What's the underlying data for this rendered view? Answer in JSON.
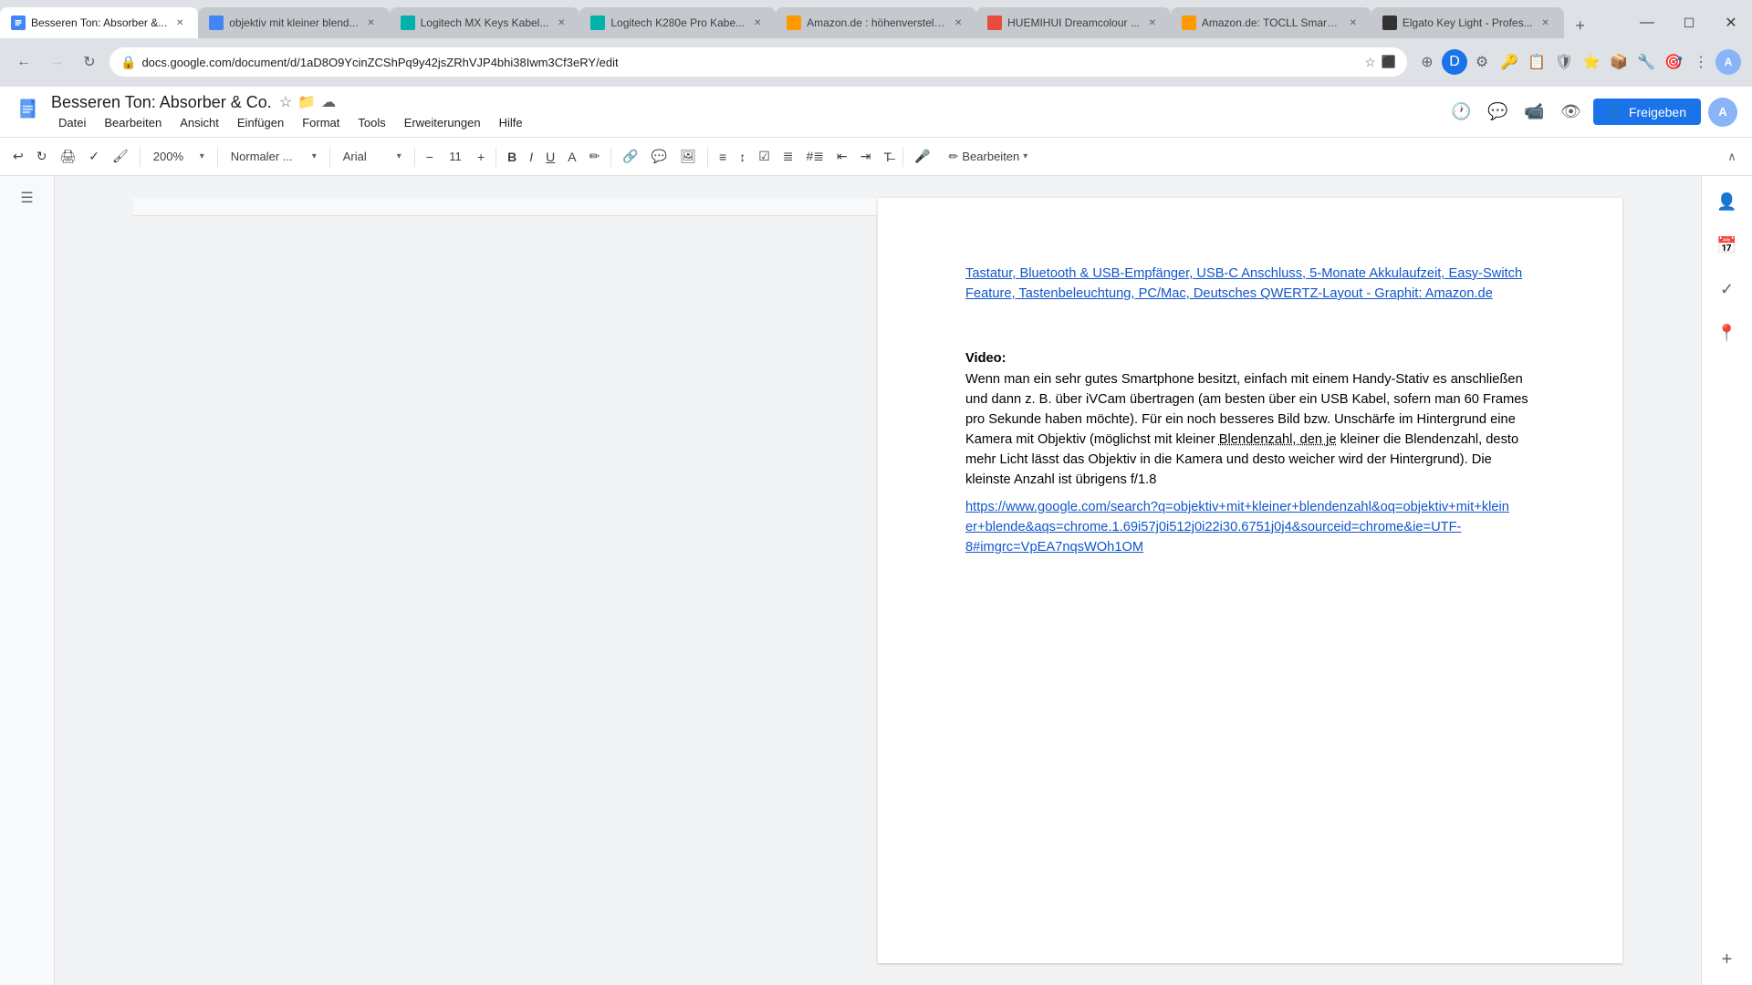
{
  "browser": {
    "tabs": [
      {
        "id": "tab1",
        "label": "Besseren Ton: Absorber &...",
        "active": true,
        "favicon_color": "#4285f4"
      },
      {
        "id": "tab2",
        "label": "objektiv mit kleiner blend...",
        "active": false,
        "favicon_color": "#4285f4"
      },
      {
        "id": "tab3",
        "label": "Logitech MX Keys Kabel...",
        "active": false,
        "favicon_color": "#00b2a9"
      },
      {
        "id": "tab4",
        "label": "Logitech K280e Pro Kabe...",
        "active": false,
        "favicon_color": "#00b2a9"
      },
      {
        "id": "tab5",
        "label": "Amazon.de : höhenverstell...",
        "active": false,
        "favicon_color": "#ff9900"
      },
      {
        "id": "tab6",
        "label": "HUEMIHUI Dreamcolour ...",
        "active": false,
        "favicon_color": "#e74c3c"
      },
      {
        "id": "tab7",
        "label": "Amazon.de: TOCLL Smart ...",
        "active": false,
        "favicon_color": "#ff9900"
      },
      {
        "id": "tab8",
        "label": "Elgato Key Light - Profes...",
        "active": false,
        "favicon_color": "#333"
      }
    ],
    "url": "docs.google.com/document/d/1aD8O9YcinZCShPq9y42jsZRhVJP4bhi38Iwm3Cf3eRY/edit",
    "nav": {
      "back_disabled": false,
      "forward_disabled": false
    }
  },
  "docs": {
    "title": "Besseren Ton: Absorber & Co.",
    "menu": {
      "items": [
        "Datei",
        "Bearbeiten",
        "Ansicht",
        "Einfügen",
        "Format",
        "Tools",
        "Erweiterungen",
        "Hilfe"
      ]
    },
    "toolbar": {
      "undo_label": "↩",
      "redo_label": "↻",
      "print_label": "🖨",
      "paint_label": "✎",
      "zoom": "200%",
      "style_dropdown": "Normaler ...",
      "font_name": "Arial",
      "font_size": "11",
      "bold": "B",
      "italic": "I",
      "underline": "U",
      "edit_mode": "Bearbeiten",
      "collapse": "∧"
    },
    "header_right": {
      "share_btn": "Freigeben"
    },
    "content": {
      "link_text": "Tastatur, Bluetooth & USB-Empfänger, USB-C Anschluss, 5-Monate Akkulaufzeit, Easy-Switch Feature, Tastenbeleuchtung, PC/Mac, Deutsches QWERTZ-Layout - Graphit: Amazon.de",
      "video_heading": "Video:",
      "video_body": "Wenn man ein sehr gutes Smartphone besitzt, einfach mit einem Handy-Stativ es anschließen und dann z. B. über iVCam übertragen (am besten über ein USB Kabel, sofern man 60 Frames pro Sekunde haben möchte). Für ein noch besseres Bild bzw. Unschärfe im Hintergrund eine Kamera mit Objektiv (möglichst mit kleiner Blendenzahl, den je kleiner die Blendenzahl, desto mehr Licht lässt das Objektiv in die Kamera und desto weicher wird der Hintergrund). Die kleinste Anzahl ist übrigens f/1.8",
      "google_link": "https://www.google.com/search?q=objektiv+mit+kleiner+blendenzahl&oq=objektiv+mit+klein er+blende&aqs=chrome.1.69i57j0i512j0i22i30.6751j0j4&sourceid=chrome&ie=UTF-8#imgrc=VpEA7nqsWOh1OM"
    }
  }
}
